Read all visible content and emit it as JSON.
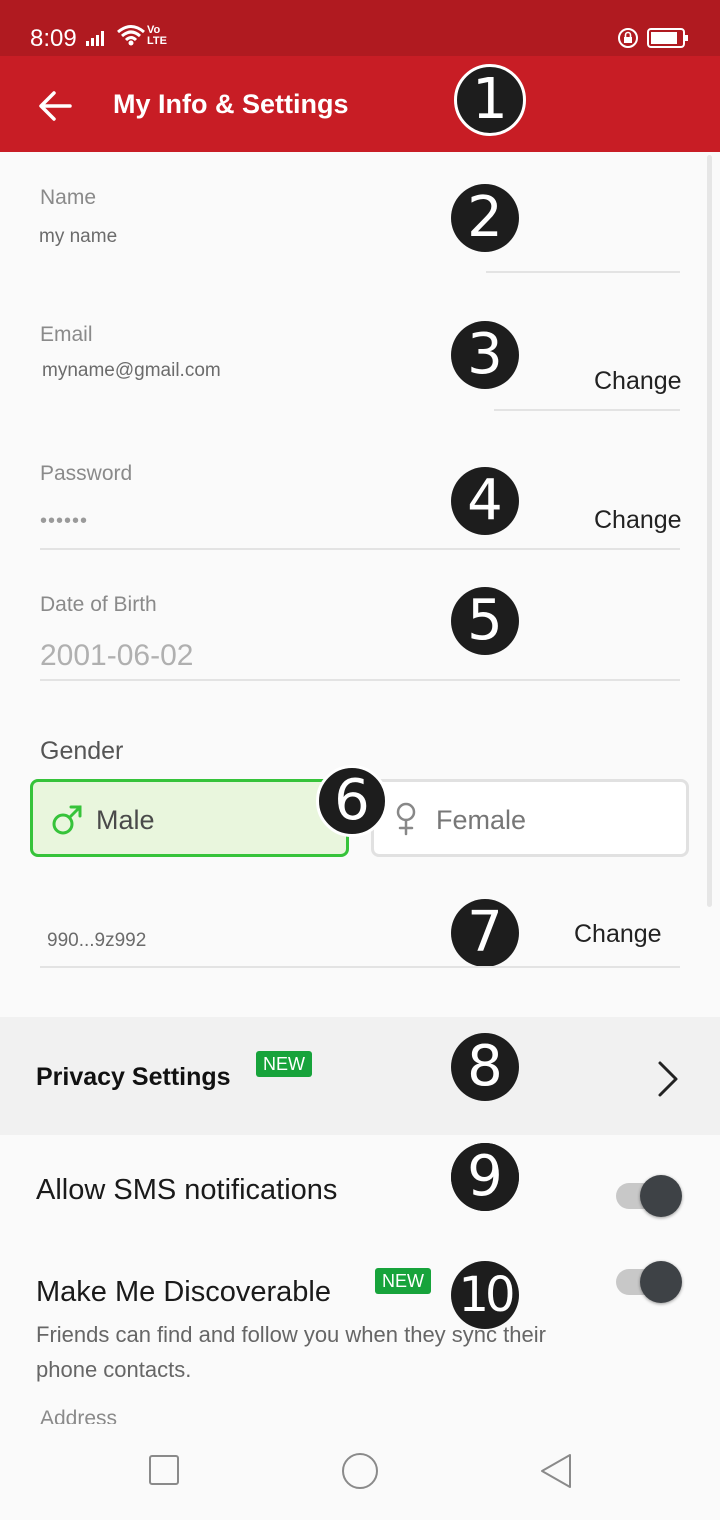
{
  "status": {
    "time": "8:09",
    "volte_top": "Vo",
    "volte_bottom": "LTE"
  },
  "appbar": {
    "title": "My Info & Settings",
    "back_icon": "arrow-left-icon"
  },
  "annotations": [
    "1",
    "2",
    "3",
    "4",
    "5",
    "6",
    "7",
    "8",
    "9",
    "10"
  ],
  "name": {
    "label": "Name",
    "value": "my name"
  },
  "email": {
    "label": "Email",
    "value": "myname@gmail.com",
    "change": "Change"
  },
  "password": {
    "label": "Password",
    "value": "••••••",
    "change": "Change"
  },
  "dob": {
    "label": "Date of Birth",
    "value": "2001-06-02"
  },
  "gender": {
    "label": "Gender",
    "male": "Male",
    "female": "Female",
    "selected": "Male"
  },
  "phone": {
    "value": "990...9z992",
    "change": "Change"
  },
  "privacy": {
    "title": "Privacy Settings",
    "tag": "NEW"
  },
  "sms": {
    "title": "Allow SMS notifications",
    "enabled": true
  },
  "discoverable": {
    "title": "Make Me Discoverable",
    "tag": "NEW",
    "subtitle": "Friends can find and follow you when they sync their phone contacts.",
    "enabled": true
  },
  "address": {
    "label": "Address"
  },
  "colors": {
    "header": "#c81d25",
    "status": "#b01a20",
    "accent_green": "#36c33a",
    "tag_green": "#17a33b"
  }
}
